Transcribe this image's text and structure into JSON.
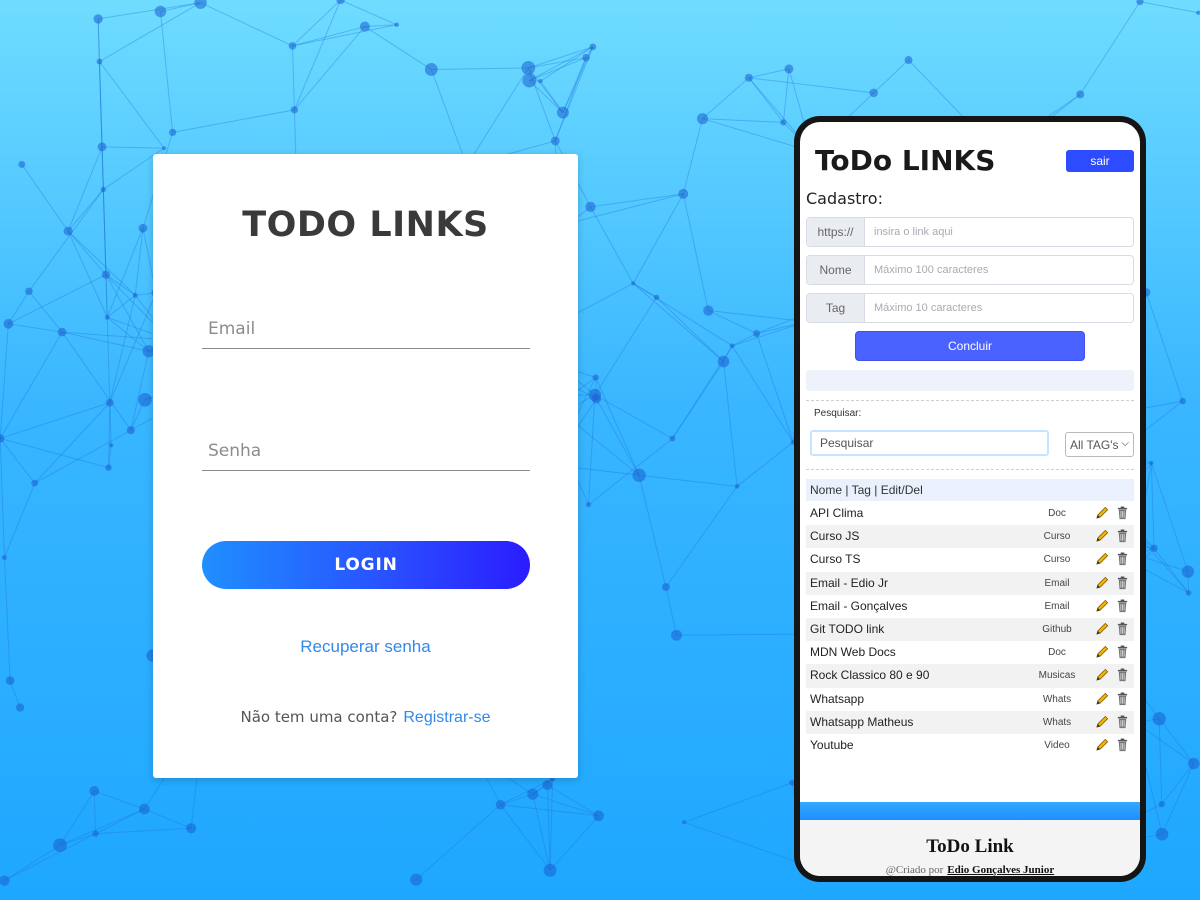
{
  "login": {
    "title": "TODO LINKS",
    "email_placeholder": "Email",
    "password_placeholder": "Senha",
    "login_label": "LOGIN",
    "recover_label": "Recuperar senha",
    "no_account_text": "Não tem uma conta?",
    "register_label": "Registrar-se"
  },
  "app": {
    "title": "ToDo LINKS",
    "logout_label": "sair",
    "cadastro_label": "Cadastro:",
    "fields": [
      {
        "prefix": "https://",
        "placeholder": "insira o link aqui"
      },
      {
        "prefix": "Nome",
        "placeholder": "Máximo 100 caracteres"
      },
      {
        "prefix": "Tag",
        "placeholder": "Máximo 10 caracteres"
      }
    ],
    "submit_label": "Concluir",
    "search_label": "Pesquisar:",
    "search_placeholder": "Pesquisar",
    "tag_filter_selected": "All TAG's",
    "table_header": "Nome | Tag | Edit/Del",
    "links": [
      {
        "name": "API Clima",
        "tag": "Doc"
      },
      {
        "name": "Curso JS",
        "tag": "Curso"
      },
      {
        "name": "Curso TS",
        "tag": "Curso"
      },
      {
        "name": "Email - Edio Jr",
        "tag": "Email"
      },
      {
        "name": "Email - Gonçalves",
        "tag": "Email"
      },
      {
        "name": "Git TODO link",
        "tag": "Github"
      },
      {
        "name": "MDN Web Docs",
        "tag": "Doc"
      },
      {
        "name": "Rock Classico 80 e 90",
        "tag": "Musicas"
      },
      {
        "name": "Whatsapp",
        "tag": "Whats"
      },
      {
        "name": "Whatsapp Matheus",
        "tag": "Whats"
      },
      {
        "name": "Youtube",
        "tag": "Video"
      }
    ],
    "footer_title": "ToDo Link",
    "footer_credit": "@Criado por",
    "footer_author": "Edio Gonçalves Junior"
  },
  "colors": {
    "accent": "#2d4bff",
    "link": "#3389e8",
    "background_top": "#6fdcff",
    "background_bottom": "#1ea7ff"
  },
  "icons": {
    "edit": "pencil-icon",
    "delete": "trash-icon",
    "select": "chevron-down-icon"
  }
}
